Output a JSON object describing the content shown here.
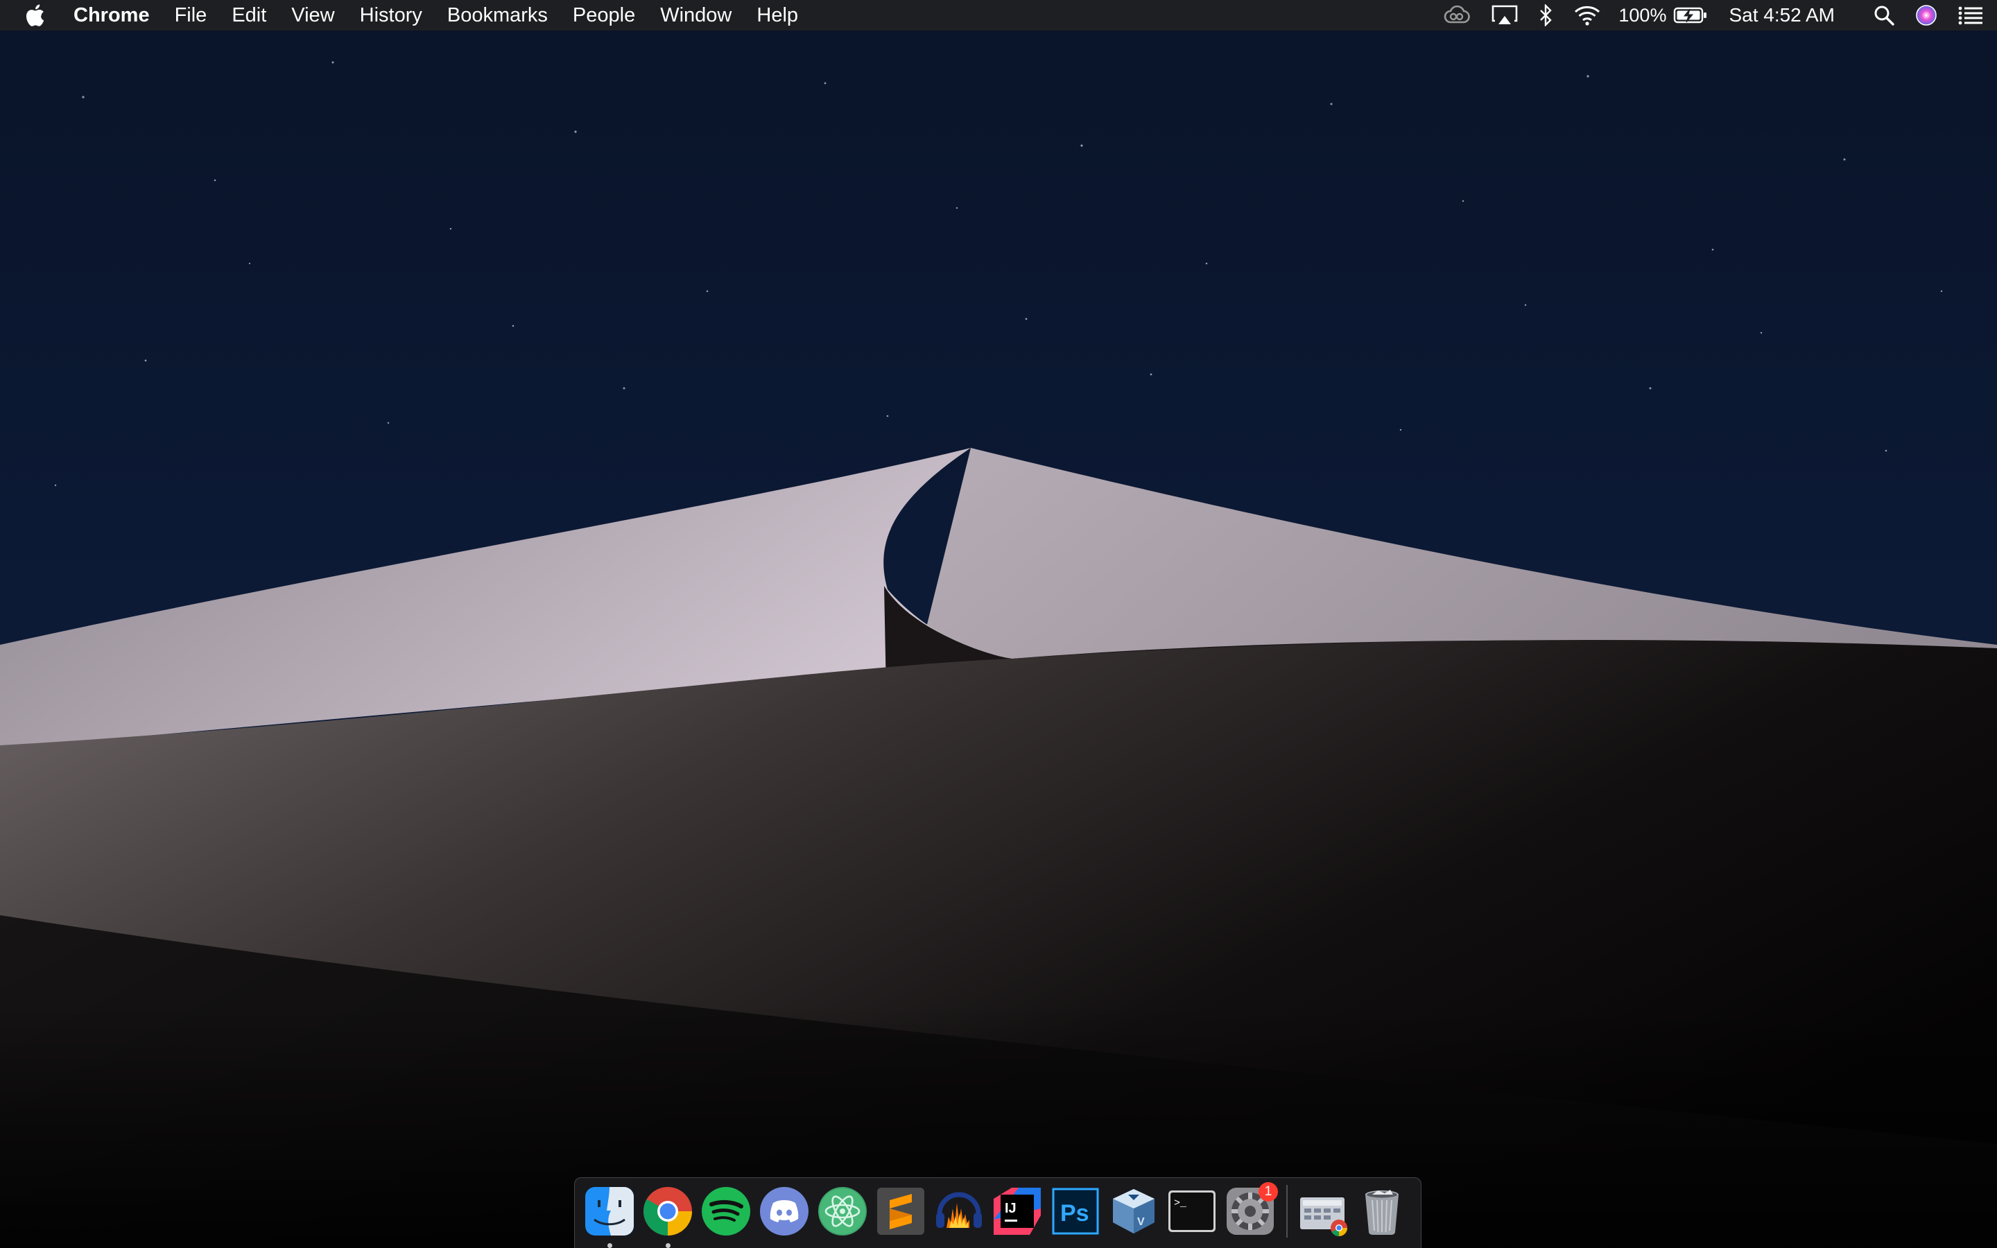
{
  "menubar": {
    "app_name": "Chrome",
    "menus": [
      "File",
      "Edit",
      "View",
      "History",
      "Bookmarks",
      "People",
      "Window",
      "Help"
    ],
    "battery_percent": "100%",
    "clock": "Sat 4:52 AM"
  },
  "dock": {
    "apps": [
      {
        "name": "Finder",
        "icon": "finder-icon",
        "running": true
      },
      {
        "name": "Google Chrome",
        "icon": "chrome-icon",
        "running": true
      },
      {
        "name": "Spotify",
        "icon": "spotify-icon",
        "running": false
      },
      {
        "name": "Discord",
        "icon": "discord-icon",
        "running": false
      },
      {
        "name": "Atom",
        "icon": "atom-icon",
        "running": false
      },
      {
        "name": "Sublime Text",
        "icon": "sublime-icon",
        "running": false
      },
      {
        "name": "Audacity",
        "icon": "audacity-icon",
        "running": false
      },
      {
        "name": "IntelliJ IDEA",
        "icon": "intellij-icon",
        "running": false
      },
      {
        "name": "Photoshop",
        "icon": "photoshop-icon",
        "running": false
      },
      {
        "name": "VirtualBox",
        "icon": "virtualbox-icon",
        "running": false
      },
      {
        "name": "Terminal",
        "icon": "terminal-icon",
        "running": false
      },
      {
        "name": "System Preferences",
        "icon": "system-preferences-icon",
        "running": false,
        "badge": "1"
      }
    ],
    "others": [
      {
        "name": "Chrome Apps",
        "icon": "chrome-apps-folder-icon"
      },
      {
        "name": "Trash",
        "icon": "trash-icon"
      }
    ],
    "ps_label": "Ps",
    "ij_label": "IJ",
    "term_prompt": ">_"
  },
  "colors": {
    "sky": "#0b1730",
    "menubar": "#1e1f22",
    "dock": "#1e1e22",
    "badge": "#ff3b30",
    "spotify": "#1db954",
    "discord": "#7289da",
    "photoshop": "#31a8ff"
  }
}
